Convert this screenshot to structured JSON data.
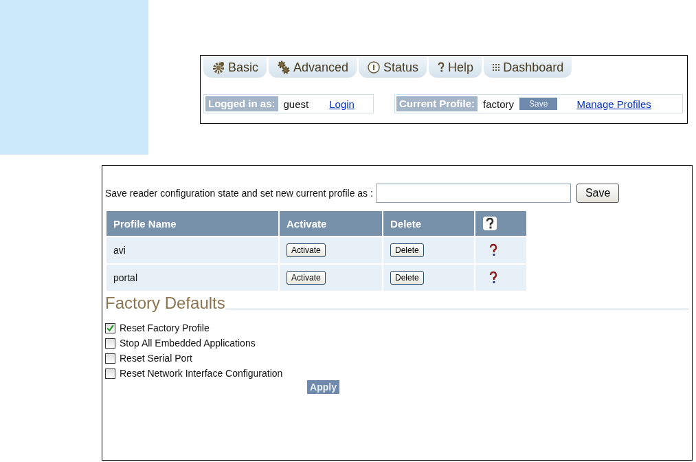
{
  "tabs": [
    {
      "label": "Basic",
      "kind": "gear"
    },
    {
      "label": "Advanced",
      "kind": "gears"
    },
    {
      "label": "Status",
      "kind": "info"
    },
    {
      "label": "Help",
      "kind": "question"
    },
    {
      "label": "Dashboard",
      "kind": "grid"
    }
  ],
  "login": {
    "label": "Logged in as:",
    "user": "guest",
    "link": "Login"
  },
  "profile": {
    "label": "Current Profile:",
    "name": "factory",
    "save_button": "Save",
    "link": "Manage Profiles"
  },
  "save_profile": {
    "label": "Save reader configuration state and set new current profile as :",
    "button": "Save"
  },
  "table": {
    "columns": [
      "Profile Name",
      "Activate",
      "Delete"
    ],
    "rows": [
      {
        "name": "avi",
        "activate": "Activate",
        "delete": "Delete"
      },
      {
        "name": "portal",
        "activate": "Activate",
        "delete": "Delete"
      }
    ]
  },
  "factory_defaults": {
    "title": "Factory Defaults",
    "options": [
      {
        "label": "Reset Factory Profile",
        "checked": true
      },
      {
        "label": "Stop All Embedded Applications",
        "checked": false
      },
      {
        "label": "Reset Serial Port",
        "checked": false
      },
      {
        "label": "Reset Network Interface Configuration",
        "checked": false
      }
    ],
    "apply_button": "Apply"
  }
}
